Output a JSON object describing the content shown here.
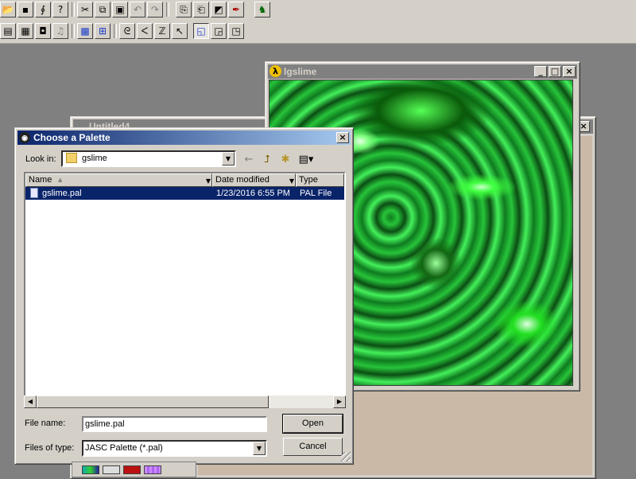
{
  "toolbar": {
    "row1_icons": [
      "open-icon",
      "save-icon",
      "link-icon",
      "help-icon",
      "cut-icon",
      "copy-icon",
      "paste-icon",
      "undo-icon",
      "redo-icon",
      "copy-image-icon",
      "paste-image-icon",
      "paste-shape-icon",
      "picker-icon",
      "run-icon"
    ],
    "row2_icons": [
      "panel-icon",
      "grid-icon",
      "camera-icon",
      "music-icon",
      "texture-grid-icon",
      "tile-grid-icon",
      "spiral-icon",
      "curve-icon",
      "wave-icon",
      "arrow-tool-icon",
      "layout-selected-icon",
      "layout-icon",
      "layout-alt-icon"
    ]
  },
  "windows": {
    "untitled": {
      "title": "Untitled4"
    },
    "image": {
      "title": "lgslime"
    }
  },
  "dialog": {
    "title": "Choose a Palette",
    "look_in_label": "Look in:",
    "look_in_value": "gslime",
    "columns": [
      "Name",
      "Date modified",
      "Type"
    ],
    "files": [
      {
        "name": "gslime.pal",
        "date": "1/23/2016 6:55 PM",
        "type": "PAL File"
      }
    ],
    "file_name_label": "File name:",
    "file_name_value": "gslime.pal",
    "file_type_label": "Files of type:",
    "file_type_value": "JASC Palette (*.pal)",
    "open_label": "Open",
    "cancel_label": "Cancel"
  }
}
